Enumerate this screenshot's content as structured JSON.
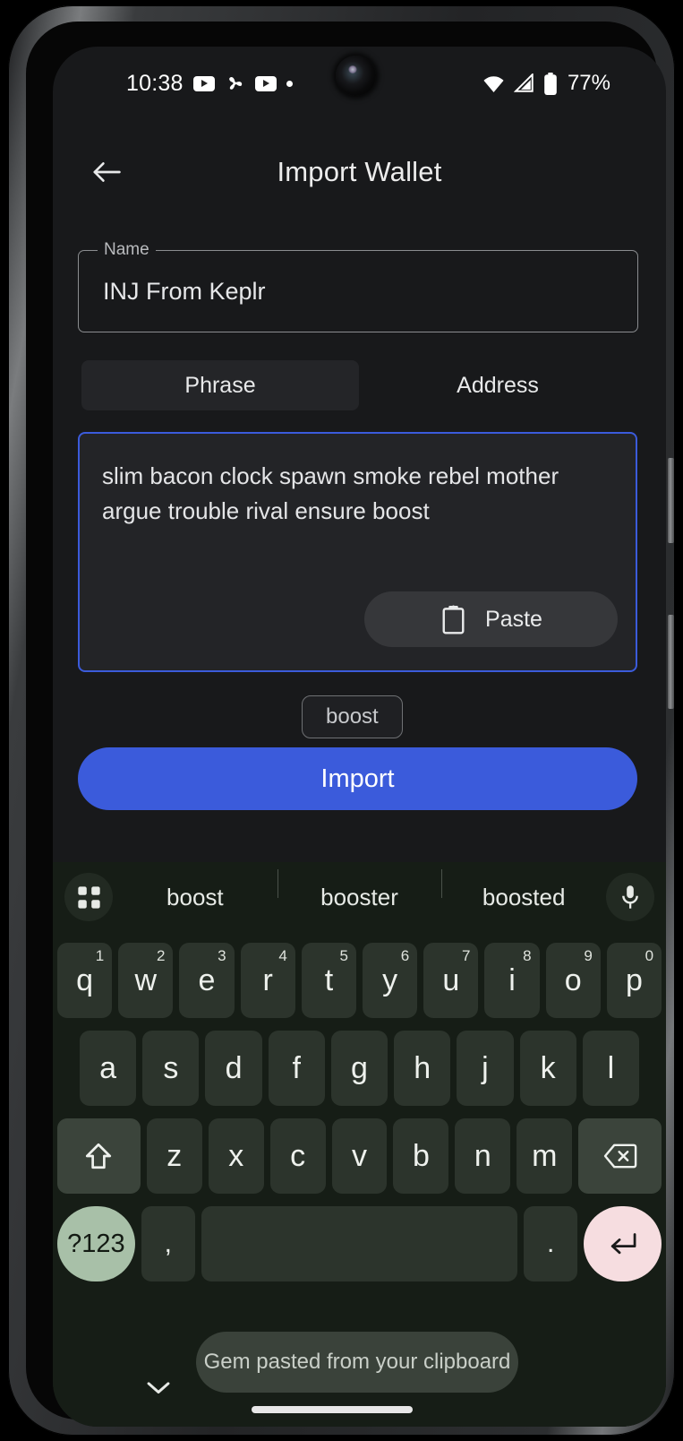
{
  "status_bar": {
    "time": "10:38",
    "icons_left": [
      "youtube-icon",
      "pinwheel-icon",
      "youtube-icon",
      "dot-indicator-icon"
    ],
    "wifi": "wifi-icon",
    "signal": "signal-icon",
    "battery": "battery-icon",
    "battery_percent": "77%"
  },
  "header": {
    "back": "back-arrow-icon",
    "title": "Import Wallet"
  },
  "name_field": {
    "label": "Name",
    "value": "INJ From Keplr"
  },
  "tabs": [
    {
      "label": "Phrase",
      "selected": true
    },
    {
      "label": "Address",
      "selected": false
    }
  ],
  "phrase_box": {
    "value": "slim bacon clock spawn smoke rebel mother argue trouble rival ensure boost",
    "paste_label": "Paste",
    "paste_icon": "clipboard-icon",
    "border_color": "#3b5bdb"
  },
  "suggestion_chip": {
    "label": "boost"
  },
  "import_button": {
    "label": "Import",
    "color": "#3b5bdb"
  },
  "keyboard": {
    "toolbar_icon": "grid-apps-icon",
    "mic_icon": "microphone-icon",
    "suggestions": [
      "boost",
      "booster",
      "boosted"
    ],
    "row1": [
      {
        "key": "q",
        "num": "1"
      },
      {
        "key": "w",
        "num": "2"
      },
      {
        "key": "e",
        "num": "3"
      },
      {
        "key": "r",
        "num": "4"
      },
      {
        "key": "t",
        "num": "5"
      },
      {
        "key": "y",
        "num": "6"
      },
      {
        "key": "u",
        "num": "7"
      },
      {
        "key": "i",
        "num": "8"
      },
      {
        "key": "o",
        "num": "9"
      },
      {
        "key": "p",
        "num": "0"
      }
    ],
    "row2": [
      "a",
      "s",
      "d",
      "f",
      "g",
      "h",
      "j",
      "k",
      "l"
    ],
    "row3": [
      "z",
      "x",
      "c",
      "v",
      "b",
      "n",
      "m"
    ],
    "shift_icon": "shift-up-arrow-icon",
    "backspace_icon": "backspace-delete-icon",
    "symbols_key": "?123",
    "comma_key": ",",
    "space_key": "",
    "period_key": ".",
    "enter_icon": "enter-return-icon",
    "symbols_color": "#a8c0a8",
    "enter_color": "#f6dde0"
  },
  "toast": {
    "message": "Gem pasted from your clipboard"
  },
  "nav_bar": {
    "hide_keyboard_icon": "chevron-down-icon",
    "home_indicator": "home-indicator-bar"
  }
}
